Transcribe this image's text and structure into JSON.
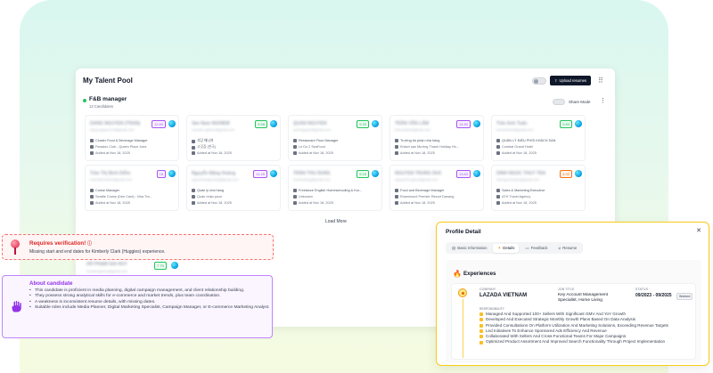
{
  "pool": {
    "title": "My Talent Pool",
    "upload_label": "Upload resumes",
    "group": {
      "title": "F&B manager",
      "count": "13 Candidates",
      "share_label": "Share Mode"
    },
    "cards": [
      {
        "name": "DANG NGUYEN (TRAN)",
        "email": "dang.nguyen123@gmail.com",
        "score": "12.83",
        "badge_color": "#a855f7",
        "role": "Cluster Food & Beverage Manager",
        "company": "Paradox Club - Queen Place Joint",
        "added": "Added at Nov 18, 2025"
      },
      {
        "name": "Van Nam NGHIEM",
        "email": "vannam.nghiem@gmail.com",
        "score": "5.58",
        "badge_color": "#22c55e",
        "role": "식당 매니저",
        "company": "고깃집 (한국)",
        "added": "Added at Nov 18, 2025"
      },
      {
        "name": "QUAN NGUYEN",
        "email": "quannguyen@gmail.com",
        "score": "9.33",
        "badge_color": "#22c55e",
        "role": "Restaurant Floor Manager",
        "company": "Le Do 2 SeaFood",
        "added": "Added at Nov 18, 2025"
      },
      {
        "name": "TRẦN VĂN LÂM",
        "email": "tranvanlam@gmail.com",
        "score": "14.83",
        "badge_color": "#a855f7",
        "role": "Trưởng bộ phận nhà hàng",
        "company": "Khách sạn Mường Thanh Holiday Hồ...",
        "added": "Added at Nov 18, 2025"
      },
      {
        "name": "Trần Anh Tuấn",
        "email": "trananhtuan@gmail.com",
        "score": "9.83",
        "badge_color": "#22c55e",
        "role": "QUẢN LÝ ĐIỀU PHỐI KHÁCH SẠN",
        "company": "Combat Grand Hotel",
        "added": "Added at Nov 18, 2025"
      },
      {
        "name": "Trần Thị Bích Diễm",
        "email": "tranthibichdiem@gmail.com",
        "score": "18",
        "badge_color": "#a855f7",
        "role": "Cruise Manager",
        "company": "Seattle Cruise (Dee Card) - Nha Tra...",
        "added": "Added at Nov 18, 2025"
      },
      {
        "name": "Nguyễn Đặng Hoàng",
        "email": "nguyendanghoang@gmail.com",
        "score": "11.25",
        "badge_color": "#a855f7",
        "role": "Quản lý nhà hàng",
        "company": "Quán nhậu puzo",
        "added": "Added at Nov 18, 2025"
      },
      {
        "name": "TRẦN THU DUNG",
        "email": "tranthudung@gmail.com",
        "score": "9.15",
        "badge_color": "#22c55e",
        "role": "Freelance English Homeschooling & Kor...",
        "company": "Unknown",
        "added": "Added at Nov 18, 2025"
      },
      {
        "name": "NGUYEN TRUNG DUC",
        "email": "nguyentrungduc@gmail.com",
        "score": "13.83",
        "badge_color": "#a855f7",
        "role": "Food and Beverage Manager",
        "company": "Rosemount Premier Resort Danang",
        "added": "Added at Nov 18, 2025"
      },
      {
        "name": "DINH NGOC THUY TRA",
        "email": "dinhngocthuytra@gmail.com",
        "score": "4.92",
        "badge_color": "#f97316",
        "role": "Sales & Marketing Executive",
        "company": "ATH Travel Agency",
        "added": "Added at Nov 18, 2025"
      }
    ],
    "load_more": "Load More",
    "extra": {
      "name": "HỒ PHẠM GIA HUY",
      "email": "hophamgiahuy@gmail.com",
      "score": "7.73"
    }
  },
  "verify": {
    "title": "Requires verification!",
    "text": "Missing start and end dates for Kimberly Clark (Huggies) experience."
  },
  "about": {
    "title": "About candidate",
    "items": [
      "This candidate is proficient in media planning, digital campaign management, and client relationship building.",
      "They possess strong analytical skills for e-commerce and market trends, plus team coordination.",
      "A weakness is inconsistent resume details, with missing dates.",
      "Suitable roles include Media Planner, Digital Marketing Specialist, Campaign Manager, or E-commerce Marketing Analyst."
    ]
  },
  "profile": {
    "title": "Profile Detail",
    "tabs": [
      "Basic Information",
      "Details",
      "Feedback",
      "Resume"
    ],
    "active_tab": "Details",
    "section_title": "Experiences",
    "company_label": "COMPANY",
    "company": "LAZADA VIETNAM",
    "job_label": "JOB TITLE",
    "job": "Key Account Management Specialist, Home Living",
    "status_label": "STATUS",
    "period": "09/2023 - 09/2025",
    "status_badge": "Worked",
    "resp_label": "RESPONSIBILITY",
    "responsibilities": [
      "Managed And Supported 100+ Sellers With Significant GMV And YoY Growth",
      "Developed And Executed Strategic Monthly Growth Plans Based On Data Analysis",
      "Provided Consultations On Platform Utilization And Marketing Solutions, Exceeding Revenue Targets",
      "Led Initiatives To Enhance Sponsored Ads Efficiency And Revenue",
      "Collaborated With Sellers And Cross-Functional Teams For Major Campaigns",
      "Optimized Product Assortment And Improved Search Functionality Through Project Implementation"
    ]
  }
}
